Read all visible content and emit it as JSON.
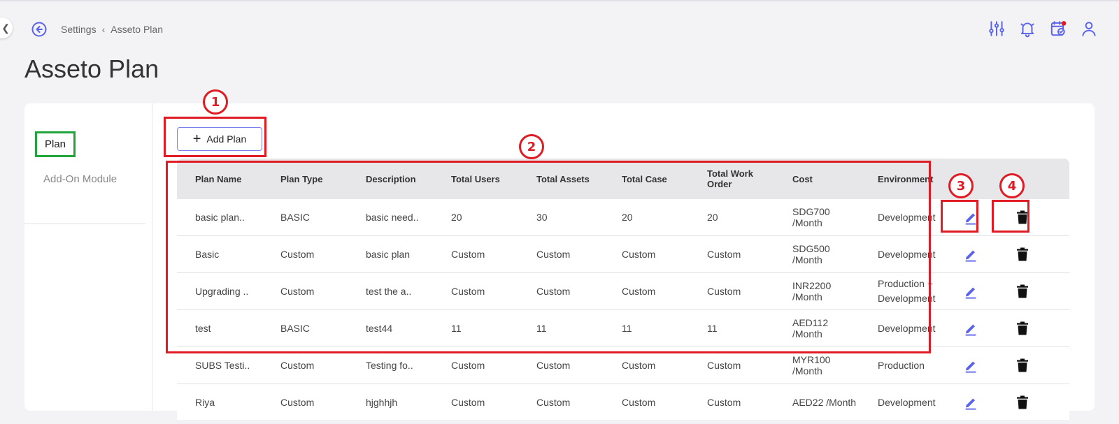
{
  "breadcrumb": {
    "parent": "Settings",
    "current": "Asseto Plan"
  },
  "page": {
    "title": "Asseto Plan"
  },
  "icons": [
    "sliders-icon",
    "bell-icon",
    "calendar-check-icon",
    "user-icon"
  ],
  "nav": {
    "plan": "Plan",
    "addon": "Add-On Module"
  },
  "toolbar": {
    "add_plan": "Add Plan"
  },
  "table": {
    "headers": [
      "Plan Name",
      "Plan Type",
      "Description",
      "Total Users",
      "Total Assets",
      "Total Case",
      "Total Work Order",
      "Cost",
      "Environment"
    ],
    "rows": [
      [
        "basic plan..",
        "BASIC",
        "basic need..",
        "20",
        "30",
        "20",
        "20",
        "SDG700 /Month",
        "Development"
      ],
      [
        "Basic",
        "Custom",
        "basic plan",
        "Custom",
        "Custom",
        "Custom",
        "Custom",
        "SDG500 /Month",
        "Development"
      ],
      [
        "Upgrading ..",
        "Custom",
        "test the a..",
        "Custom",
        "Custom",
        "Custom",
        "Custom",
        "INR2200 /Month",
        "Production + Development"
      ],
      [
        "test",
        "BASIC",
        "test44",
        "11",
        "11",
        "11",
        "11",
        "AED112 /Month",
        "Development"
      ],
      [
        "SUBS Testi..",
        "Custom",
        "Testing fo..",
        "Custom",
        "Custom",
        "Custom",
        "Custom",
        "MYR100 /Month",
        "Production"
      ],
      [
        "Riya",
        "Custom",
        "hjghhjh",
        "Custom",
        "Custom",
        "Custom",
        "Custom",
        "AED22 /Month",
        "Development"
      ]
    ]
  },
  "annotations": [
    "1",
    "2",
    "3",
    "4"
  ],
  "colors": {
    "accent": "#5b63e8",
    "annotation": "#e01b24",
    "nav_highlight": "#1fa53a"
  }
}
